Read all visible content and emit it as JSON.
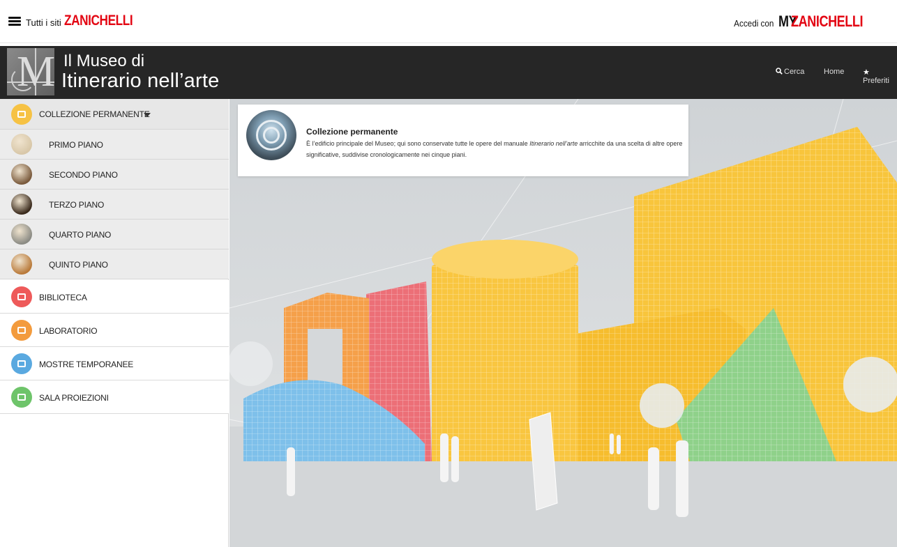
{
  "topbar": {
    "tutti_label": "Tutti i siti",
    "brand": "ZANICHELLI",
    "accedi_label": "Accedi con",
    "my_label": "MY",
    "my_brand": "ZANICHELLI"
  },
  "header": {
    "subtitle": "Il Museo di",
    "title": "Itinerario nell’arte",
    "logo_letter": "M",
    "nav": {
      "search": "Cerca",
      "home": "Home",
      "favorites": "Preferiti"
    }
  },
  "sidebar": {
    "collection": {
      "label": "COLLEZIONE PERMANENTE",
      "color": "#f6c244"
    },
    "floors": [
      {
        "label": "PRIMO PIANO",
        "thumb_color": "#d8c7a8"
      },
      {
        "label": "SECONDO PIANO",
        "thumb_color": "#7a5a3c"
      },
      {
        "label": "TERZO PIANO",
        "thumb_color": "#3a2a1c"
      },
      {
        "label": "QUARTO PIANO",
        "thumb_color": "#8b8b84"
      },
      {
        "label": "QUINTO PIANO",
        "thumb_color": "#b97a3a"
      }
    ],
    "sections": [
      {
        "label": "BIBLIOTECA",
        "color": "#ee5a5a"
      },
      {
        "label": "LABORATORIO",
        "color": "#f39b3d"
      },
      {
        "label": "MOSTRE TEMPORANEE",
        "color": "#5aa9e0"
      },
      {
        "label": "SALA PROIEZIONI",
        "color": "#6ec46a"
      }
    ]
  },
  "card": {
    "title": "Collezione permanente",
    "text_before": "È l’edificio principale del Museo; qui sono conservate tutte le opere del manuale ",
    "text_italic": "Itinerario nell’arte",
    "text_after": " arricchite da una scelta di altre opere significative, suddivise cronologicamente nei cinque piani."
  },
  "colors": {
    "brand_red": "#e30613",
    "header_bg": "#262626",
    "building_yellow": "#f8c53c",
    "building_orange": "#f5a04a",
    "building_pink": "#ec6f77",
    "building_blue": "#7ec0ea",
    "building_green": "#8fd18a"
  }
}
